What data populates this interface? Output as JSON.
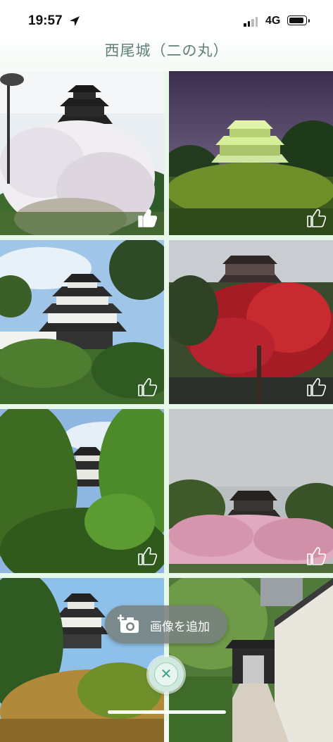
{
  "status_bar": {
    "time": "19:57",
    "network": "4G",
    "location_icon": "location-arrow-icon",
    "signal_icon": "signal-bars-icon",
    "battery_icon": "battery-icon"
  },
  "header": {
    "title": "西尾城（二の丸）"
  },
  "photos": [
    {
      "subject": "castle-cherry-blossom-lamp",
      "liked": true
    },
    {
      "subject": "castle-night-illuminated",
      "liked": false
    },
    {
      "subject": "castle-blue-sky",
      "liked": false
    },
    {
      "subject": "castle-autumn-leaves",
      "liked": false
    },
    {
      "subject": "castle-behind-trees",
      "liked": false
    },
    {
      "subject": "castle-cherry-blossom-cloudy",
      "liked": false
    },
    {
      "subject": "castle-sunny-hill",
      "liked": false
    },
    {
      "subject": "gate-path-wall",
      "liked": false
    }
  ],
  "actions": {
    "add_image_label": "画像を追加",
    "add_image_icon": "camera-plus-icon",
    "close_icon": "close-icon"
  },
  "colors": {
    "accent": "#3d9f86",
    "title": "#5f7f7a",
    "grid_bg": "#e7f7e9"
  }
}
